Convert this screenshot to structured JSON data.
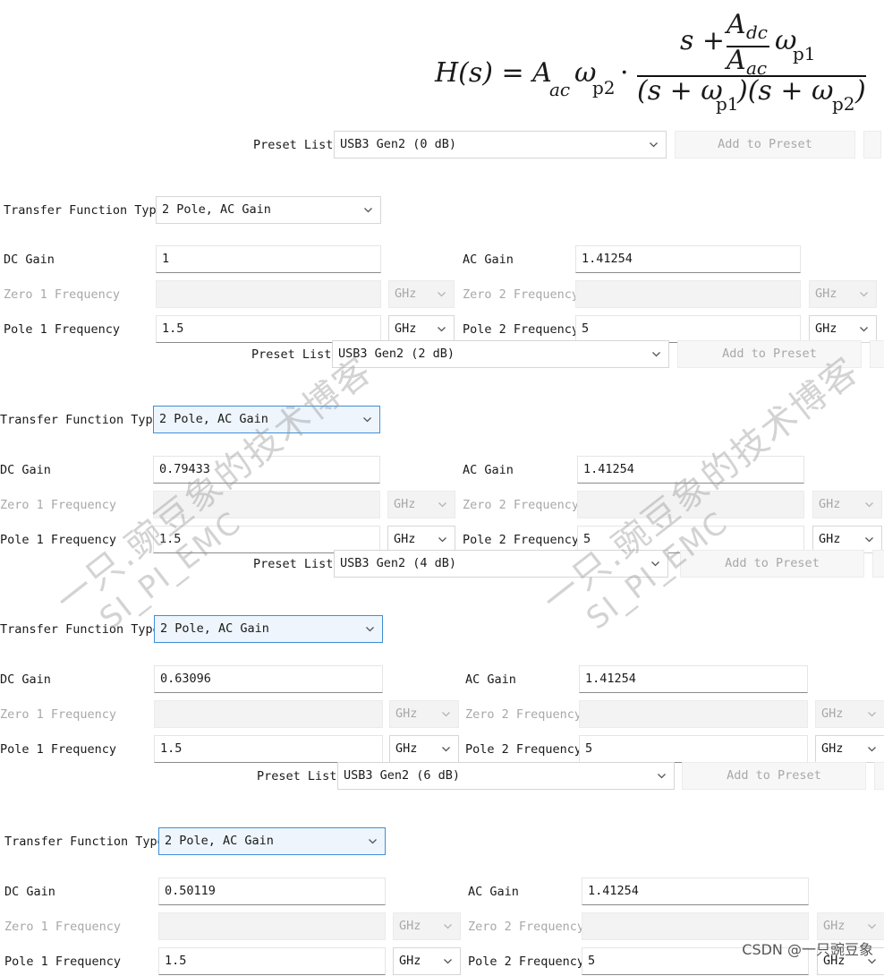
{
  "formula": {
    "lhs": "H(s) = A",
    "lhs_sub": "ac",
    "omega": "ω",
    "omega_sub": "p2",
    "dot": "·",
    "num_s": "s +",
    "adc": "A",
    "adc_sub": "dc",
    "aac": "A",
    "aac_sub": "ac",
    "num_omega": "ω",
    "num_omega_sub": "p1",
    "den": "(s + ω",
    "den_sub1": "p1",
    "den_mid": ")(s + ω",
    "den_sub2": "p2",
    "den_end": ")"
  },
  "labels": {
    "preset_list": "Preset List",
    "add_to_preset": "Add to Preset",
    "transfer_function_type": "Transfer Function Type",
    "dc_gain": "DC Gain",
    "ac_gain": "AC Gain",
    "zero1": "Zero 1 Frequency",
    "zero2": "Zero 2 Frequency",
    "pole1": "Pole 1 Frequency",
    "pole2": "Pole 2 Frequency",
    "unit": "GHz"
  },
  "panels": [
    {
      "preset": "USB3 Gen2 (0 dB)",
      "tf_type": "2 Pole, AC Gain",
      "dc_gain": "1",
      "ac_gain": "1.41254",
      "pole1": "1.5",
      "pole2": "5"
    },
    {
      "preset": "USB3 Gen2 (2 dB)",
      "tf_type": "2 Pole, AC Gain",
      "dc_gain": "0.79433",
      "ac_gain": "1.41254",
      "pole1": "1.5",
      "pole2": "5"
    },
    {
      "preset": "USB3 Gen2 (4 dB)",
      "tf_type": "2 Pole, AC Gain",
      "dc_gain": "0.63096",
      "ac_gain": "1.41254",
      "pole1": "1.5",
      "pole2": "5"
    },
    {
      "preset": "USB3 Gen2 (6 dB)",
      "tf_type": "2 Pole, AC Gain",
      "dc_gain": "0.50119",
      "ac_gain": "1.41254",
      "pole1": "1.5",
      "pole2": "5"
    }
  ],
  "watermark": {
    "cn": "一只.豌豆象的技术博客",
    "en": "SI_PI_EMC"
  },
  "credit": "CSDN @一只豌豆象",
  "colors": {
    "focus_border": "#3f8fd6",
    "focus_fill": "#eef5fc",
    "disabled_text": "#a8a8a8"
  }
}
